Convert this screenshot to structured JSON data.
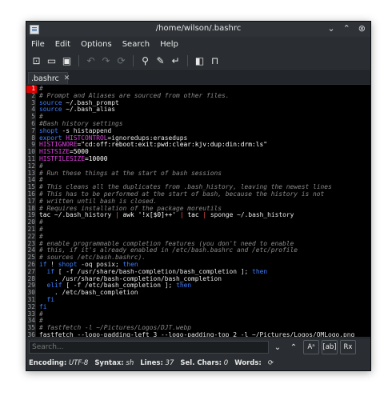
{
  "window": {
    "title": "/home/wilson/.bashrc"
  },
  "window_controls": {
    "minimize": "⌄",
    "maximize": "⌃",
    "close": "⊗"
  },
  "menu": [
    "File",
    "Edit",
    "Options",
    "Search",
    "Help"
  ],
  "toolbar": [
    {
      "name": "new-file-icon",
      "glyph": "⊡",
      "enabled": true
    },
    {
      "name": "open-folder-icon",
      "glyph": "▭",
      "enabled": true
    },
    {
      "name": "save-icon",
      "glyph": "▣",
      "enabled": true
    },
    {
      "name": "sep"
    },
    {
      "name": "undo-icon",
      "glyph": "↶",
      "enabled": false
    },
    {
      "name": "redo-icon",
      "glyph": "↷",
      "enabled": false
    },
    {
      "name": "reload-icon",
      "glyph": "⟳",
      "enabled": false
    },
    {
      "name": "sep"
    },
    {
      "name": "find-icon",
      "glyph": "⚲",
      "enabled": true
    },
    {
      "name": "find-replace-icon",
      "glyph": "✎",
      "enabled": true
    },
    {
      "name": "jump-to-line-icon",
      "glyph": "↵",
      "enabled": true
    },
    {
      "name": "sep"
    },
    {
      "name": "side-pane-icon",
      "glyph": "◧",
      "enabled": true
    },
    {
      "name": "bookmark-icon",
      "glyph": "⊓",
      "enabled": true
    }
  ],
  "tab": {
    "label": ".bashrc",
    "close": "✕"
  },
  "colors": {
    "comment": "#8a8a8a",
    "keyword": "#3f7fff",
    "variable": "#e040e0",
    "string": "#ffffff",
    "number": "#ffffff",
    "command": "#ffffff",
    "text": "#e6e6e6",
    "operator": "#ff5252",
    "active_line_bg": "#e00000"
  },
  "editor": {
    "active_line": 1,
    "lines": [
      [
        {
          "t": "#",
          "c": "comment"
        }
      ],
      [
        {
          "t": "# Prompt and Aliases are sourced from other files.",
          "c": "comment"
        }
      ],
      [
        {
          "t": "source",
          "c": "keyword"
        },
        {
          "t": " ~/.bash_prompt",
          "c": "text"
        }
      ],
      [
        {
          "t": "source",
          "c": "keyword"
        },
        {
          "t": " ~/.bash_alias",
          "c": "text"
        }
      ],
      [
        {
          "t": "#",
          "c": "comment"
        }
      ],
      [
        {
          "t": "#Bash history settings",
          "c": "comment"
        }
      ],
      [
        {
          "t": "shopt",
          "c": "keyword"
        },
        {
          "t": " -s histappend",
          "c": "text"
        }
      ],
      [
        {
          "t": "export",
          "c": "keyword"
        },
        {
          "t": " ",
          "c": "text"
        },
        {
          "t": "HISTCONTROL",
          "c": "variable"
        },
        {
          "t": "=ignoredups:erasedups",
          "c": "text"
        }
      ],
      [
        {
          "t": "HISTIGNORE",
          "c": "variable"
        },
        {
          "t": "=\"cd:off:reboot:exit:pwd:clear:kjv:dup:din:drm:ls\"",
          "c": "string"
        }
      ],
      [
        {
          "t": "HISTSIZE",
          "c": "variable"
        },
        {
          "t": "=5000",
          "c": "number"
        }
      ],
      [
        {
          "t": "HISTFILESIZE",
          "c": "variable"
        },
        {
          "t": "=10000",
          "c": "number"
        }
      ],
      [
        {
          "t": "#",
          "c": "comment"
        }
      ],
      [
        {
          "t": "# Run these things at the start of bash sessions",
          "c": "comment"
        }
      ],
      [
        {
          "t": "#",
          "c": "comment"
        }
      ],
      [
        {
          "t": "# This cleans all the duplicates from .bash_history, leaving the newest lines",
          "c": "comment"
        }
      ],
      [
        {
          "t": "# This has to be performed at the start of bash, because the history is not",
          "c": "comment"
        }
      ],
      [
        {
          "t": "# written until bash is closed.",
          "c": "comment"
        }
      ],
      [
        {
          "t": "# Requires installation of the package moreutils",
          "c": "comment"
        }
      ],
      [
        {
          "t": "tac",
          "c": "command"
        },
        {
          "t": " ~/.bash_history ",
          "c": "text"
        },
        {
          "t": "|",
          "c": "operator"
        },
        {
          "t": " awk ",
          "c": "command"
        },
        {
          "t": "'!x[$0]++'",
          "c": "string"
        },
        {
          "t": " ",
          "c": "text"
        },
        {
          "t": "|",
          "c": "operator"
        },
        {
          "t": " tac ",
          "c": "command"
        },
        {
          "t": "|",
          "c": "operator"
        },
        {
          "t": " sponge ~/.bash_history",
          "c": "text"
        }
      ],
      [
        {
          "t": "#",
          "c": "comment"
        }
      ],
      [
        {
          "t": "#",
          "c": "comment"
        }
      ],
      [
        {
          "t": "#",
          "c": "comment"
        }
      ],
      [
        {
          "t": "# enable programmable completion features (you don't need to enable",
          "c": "comment"
        }
      ],
      [
        {
          "t": "# this, if it's already enabled in /etc/bash.bashrc and /etc/profile",
          "c": "comment"
        }
      ],
      [
        {
          "t": "# sources /etc/bash.bashrc).",
          "c": "comment"
        }
      ],
      [
        {
          "t": "if",
          "c": "keyword"
        },
        {
          "t": " ! ",
          "c": "text"
        },
        {
          "t": "shopt",
          "c": "keyword"
        },
        {
          "t": " -oq posix; ",
          "c": "text"
        },
        {
          "t": "then",
          "c": "keyword"
        }
      ],
      [
        {
          "t": "  ",
          "c": "text"
        },
        {
          "t": "if",
          "c": "keyword"
        },
        {
          "t": " [ -f /usr/share/bash-completion/bash_completion ]; ",
          "c": "text"
        },
        {
          "t": "then",
          "c": "keyword"
        }
      ],
      [
        {
          "t": "    . /usr/share/bash-completion/bash_completion",
          "c": "text"
        }
      ],
      [
        {
          "t": "  ",
          "c": "text"
        },
        {
          "t": "elif",
          "c": "keyword"
        },
        {
          "t": " [ -f /etc/bash_completion ]; ",
          "c": "text"
        },
        {
          "t": "then",
          "c": "keyword"
        }
      ],
      [
        {
          "t": "    . /etc/bash_completion",
          "c": "text"
        }
      ],
      [
        {
          "t": "  ",
          "c": "text"
        },
        {
          "t": "fi",
          "c": "keyword"
        }
      ],
      [
        {
          "t": "fi",
          "c": "keyword"
        }
      ],
      [
        {
          "t": "#",
          "c": "comment"
        }
      ],
      [
        {
          "t": "#",
          "c": "comment"
        }
      ],
      [
        {
          "t": "# fastfetch -l ~/Pictures/Logos/DJT.webp",
          "c": "comment"
        }
      ],
      [
        {
          "t": "fastfetch --logo-padding-left 3 --logo-padding-top 2 -l ~/Pictures/Logos/OMLogo.png",
          "c": "text"
        }
      ],
      []
    ]
  },
  "search": {
    "placeholder": "Search...",
    "buttons": [
      {
        "name": "find-previous-icon",
        "glyph": "⌄",
        "boxed": false
      },
      {
        "name": "find-next-icon",
        "glyph": "⌃",
        "boxed": false
      },
      {
        "name": "match-case-icon",
        "glyph": "Aᵃ",
        "boxed": true
      },
      {
        "name": "whole-word-icon",
        "glyph": "[ab]",
        "boxed": true
      },
      {
        "name": "regex-icon",
        "glyph": "Rx",
        "boxed": true
      }
    ]
  },
  "status": {
    "encoding_label": "Encoding:",
    "encoding_value": "UTF-8",
    "syntax_label": "Syntax:",
    "syntax_value": "sh",
    "lines_label": "Lines:",
    "lines_value": "37",
    "selchars_label": "Sel. Chars:",
    "selchars_value": "0",
    "words_label": "Words:",
    "words_value": "",
    "refresh_glyph": "⟳"
  }
}
